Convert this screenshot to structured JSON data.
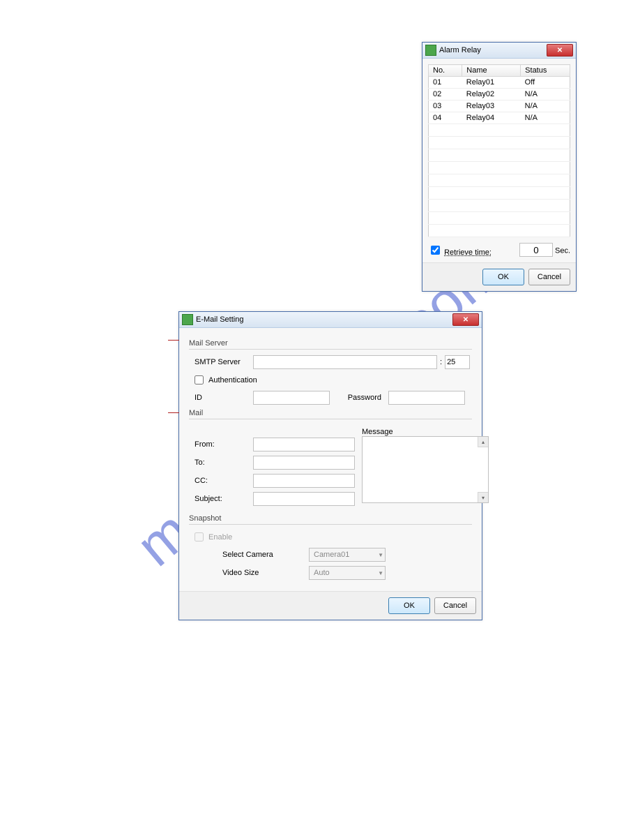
{
  "watermark": "manualshive.com",
  "alarm": {
    "title": "Alarm Relay",
    "columns": {
      "no": "No.",
      "name": "Name",
      "status": "Status"
    },
    "rows": [
      {
        "no": "01",
        "name": "Relay01",
        "status": "Off"
      },
      {
        "no": "02",
        "name": "Relay02",
        "status": "N/A"
      },
      {
        "no": "03",
        "name": "Relay03",
        "status": "N/A"
      },
      {
        "no": "04",
        "name": "Relay04",
        "status": "N/A"
      }
    ],
    "retrieve_label": "Retrieve time:",
    "retrieve_value": "0",
    "retrieve_unit": "Sec.",
    "ok": "OK",
    "cancel": "Cancel"
  },
  "email": {
    "title": "E-Mail Setting",
    "section_mailserver": "Mail Server",
    "smtp_label": "SMTP Server",
    "port_sep": ":",
    "port_value": "25",
    "auth_label": "Authentication",
    "id_label": "ID",
    "pw_label": "Password",
    "section_mail": "Mail",
    "message_label": "Message",
    "from_label": "From:",
    "to_label": "To:",
    "cc_label": "CC:",
    "subject_label": "Subject:",
    "section_snapshot": "Snapshot",
    "enable_label": "Enable",
    "select_camera_label": "Select Camera",
    "select_camera_value": "Camera01",
    "video_size_label": "Video Size",
    "video_size_value": "Auto",
    "ok": "OK",
    "cancel": "Cancel"
  }
}
